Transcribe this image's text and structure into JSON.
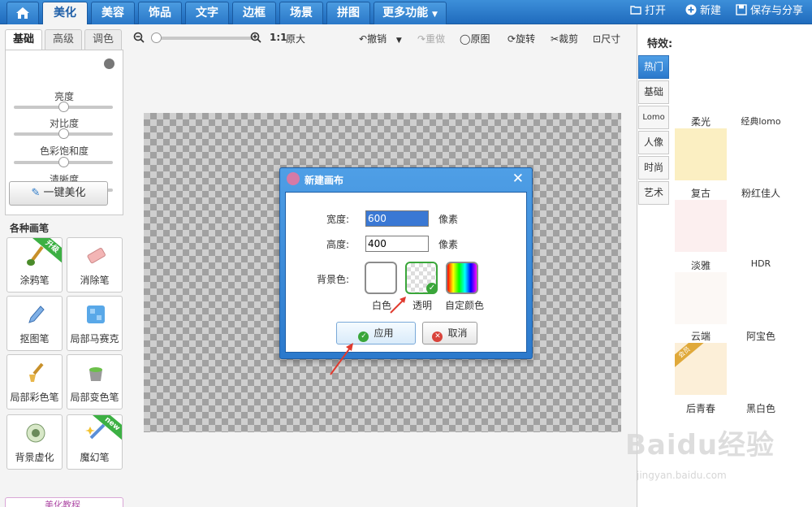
{
  "nav": {
    "tabs": [
      "美化",
      "美容",
      "饰品",
      "文字",
      "边框",
      "场景",
      "拼图",
      "更多功能"
    ],
    "active": "美化",
    "right": {
      "open": "打开",
      "new": "新建",
      "save": "保存与分享"
    }
  },
  "left": {
    "subtabs": [
      "基础",
      "高级",
      "调色"
    ],
    "sliders": [
      "亮度",
      "对比度",
      "色彩饱和度",
      "清晰度"
    ],
    "one_key": "一键美化",
    "brushes_title": "各种画笔",
    "brushes": [
      {
        "label": "涂鸦笔",
        "badge": "升级"
      },
      {
        "label": "消除笔",
        "badge": ""
      },
      {
        "label": "抠图笔",
        "badge": ""
      },
      {
        "label": "局部马赛克",
        "badge": ""
      },
      {
        "label": "局部彩色笔",
        "badge": ""
      },
      {
        "label": "局部变色笔",
        "badge": ""
      },
      {
        "label": "背景虚化",
        "badge": ""
      },
      {
        "label": "魔幻笔",
        "badge": "new"
      }
    ],
    "tutorial": "美化教程"
  },
  "toolbar": {
    "ratio": "1:1",
    "original_size": "原大",
    "undo": "撤销",
    "redo": "重做",
    "original": "原图",
    "rotate": "旋转",
    "crop": "裁剪",
    "size": "尺寸"
  },
  "dialog": {
    "title": "新建画布",
    "width_label": "宽度:",
    "width_value": "600",
    "height_label": "高度:",
    "height_value": "400",
    "unit": "像素",
    "bg_label": "背景色:",
    "options": [
      "白色",
      "透明",
      "自定颜色"
    ],
    "selected": "透明",
    "apply": "应用",
    "cancel": "取消"
  },
  "right": {
    "title": "特效:",
    "categories": [
      "热门",
      "基础",
      "Lomo",
      "人像",
      "时尚",
      "艺术"
    ],
    "effects": [
      "柔光",
      "经典lomo",
      "复古",
      "粉红佳人",
      "淡雅",
      "HDR",
      "云端",
      "阿宝色",
      "后青春",
      "黑白色"
    ],
    "effect_badge": "会员"
  },
  "watermark": {
    "brand": "Baidu经验",
    "url": "jingyan.baidu.com"
  },
  "colors": {
    "accent": "#2b79cc",
    "selected_green": "#3aa63a"
  }
}
